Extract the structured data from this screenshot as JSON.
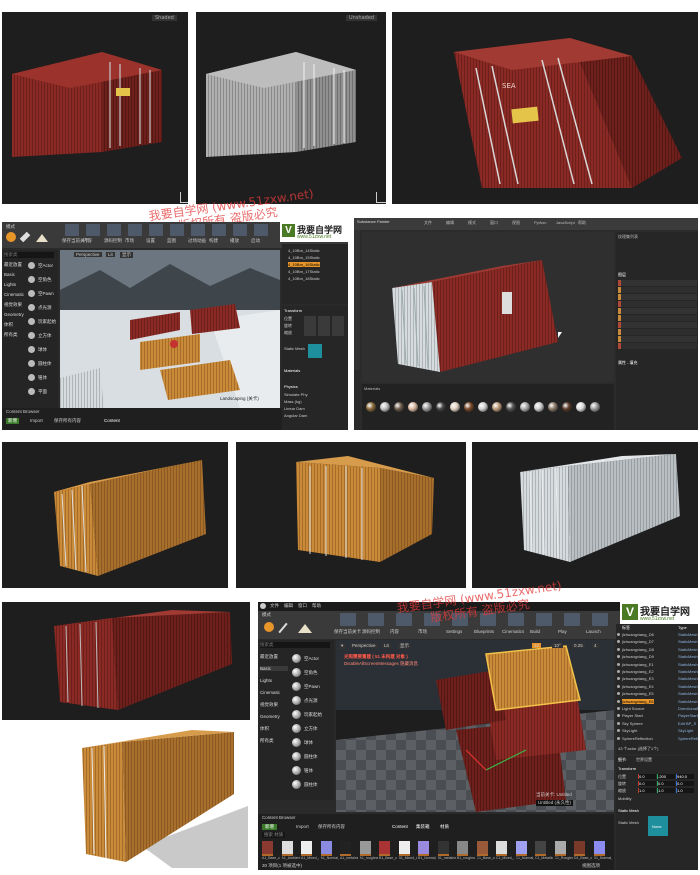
{
  "watermarks": {
    "top_line1": "我要自学网 (www.51zxw.net)",
    "top_line2": "版权所有 盗版必究",
    "bottom_line1": "我要自学网 (www.51zxw.net)",
    "bottom_line2": "版权所有 盗版必究"
  },
  "colors": {
    "red_container": "#8a2a25",
    "orange_container": "#c98a3a",
    "white_container": "#cfd4d6",
    "gray_container": "#a8a8a8",
    "ue_bg": "#2a2a2a",
    "accent_orange": "#e8962a"
  },
  "renders_top": {
    "p1_dropdown": "Shaded",
    "p2_dropdown": "Unshaded"
  },
  "ue_top": {
    "toolbar": [
      "保存当前关卡",
      "内容",
      "源码控制",
      "市场",
      "设置",
      "蓝图",
      "过场动画",
      "构建",
      "播放",
      "启动"
    ],
    "modes_label": "模式",
    "search_placeholder": "搜索类",
    "side_items": [
      "最近放置",
      "Basic",
      "Lights",
      "Cinematic",
      "视觉效果",
      "Geometry",
      "体积",
      "所有类"
    ],
    "place_items": [
      "空Actor",
      "空角色",
      "空Pawn",
      "点光源",
      "玩家起始",
      "立方体",
      "球体",
      "圆柱体",
      "锥体",
      "平面"
    ],
    "viewport_label": "Perspective",
    "viewport_lit": "Lit",
    "viewport_show": "显示",
    "viewport_name": "Landscaping (关卡)",
    "content_browser": "Content Browser",
    "add_new": "新增",
    "import_label": "Import",
    "save_all": "保存所有内容",
    "content_path": "Content",
    "outliner_rows": [
      "4_10Bm_14Static",
      "4_10Bm_15Static",
      "4_10Bm_16Static",
      "4_10Bm_17Static",
      "4_10Bm_18Static"
    ],
    "details": {
      "transform": "Transform",
      "location": "位置",
      "rotation": "旋转",
      "scale": "缩放",
      "static_mesh": "Static Mesh",
      "materials": "Materials",
      "physics": "Physics",
      "simulate": "Simulate Phy",
      "mass": "Mass (kg)",
      "linear_damp": "Linear Dam",
      "angular_damp": "Angular Dam"
    }
  },
  "sp": {
    "title": "Substance Painter",
    "tabs": [
      "文件",
      "编辑",
      "模式",
      "窗口",
      "视图",
      "Python",
      "JavaScript",
      "帮助"
    ],
    "shelf_label": "Materials",
    "layers_label": "图层",
    "properties_label": "属性 - 填充",
    "texture_set": "纹理集列表"
  },
  "ue_bottom": {
    "menu": [
      "文件",
      "编辑",
      "窗口",
      "帮助"
    ],
    "modes_label": "模式",
    "search_placeholder": "搜索类",
    "side_items": [
      "最近放置",
      "Basic",
      "Lights",
      "Cinematic",
      "视觉效果",
      "Geometry",
      "体积",
      "所有类"
    ],
    "place_items": [
      "空Actor",
      "空角色",
      "空Pawn",
      "点光源",
      "玩家起始",
      "立方体",
      "球体",
      "圆柱体",
      "锥体",
      "圆柱体"
    ],
    "toolbar": [
      "保存当前关卡",
      "源码控制",
      "内容",
      "市场",
      "Settings",
      "Blueprints",
      "Cinematics",
      "Build",
      "Play",
      "Launch"
    ],
    "viewport_label": "Perspective",
    "viewport_lit": "Lit",
    "viewport_show": "显示",
    "viewport_msg_title": "光照需要重建 ( 51 未构建 对象 )",
    "viewport_msg_sub": "DisableAllScreenMessages 隐藏消息",
    "viewport_level": "Untitled (永久性)",
    "viewport_level2": "当前关卡: Untitled",
    "snap_values": [
      "10",
      "10°",
      "0.25",
      "4"
    ],
    "content_browser": "Content Browser",
    "add_new": "新增",
    "import_label": "Import",
    "save_all": "保存所有内容",
    "breadcrumbs": [
      "Content",
      "集装箱",
      "材质"
    ],
    "search_label": "搜索 材质",
    "assets": [
      "A1_Base_color",
      "A1_Ambient_Occlu",
      "A1_Mixed_AO",
      "A1_Normal_DirectX",
      "A1_metalness",
      "A1_roughness",
      "B1_Base_color",
      "B1_Mixed_AO",
      "B1_Normal_DirectX",
      "B1_metalness",
      "B1_roughness",
      "C1_Base_color",
      "C1_Mixed_AO",
      "C1_Normal_OpenGL",
      "C1_Metallic",
      "C1_Roughness",
      "D1_Base_color",
      "D1_Normal_OpenGL"
    ],
    "items_count": "30 项目(1 项被选中)",
    "view_options": "视图选项",
    "outliner_header": "标签",
    "outliner_type": "Type",
    "outliner_rows": [
      "jizhuangxiang_D6",
      "jizhuangxiang_D7",
      "jizhuangxiang_D8",
      "jizhuangxiang_D9",
      "jizhuangxiang_E1",
      "jizhuangxiang_E2",
      "jizhuangxiang_E3",
      "jizhuangxiang_E4",
      "jizhuangxiang_E5",
      "jizhuangxiang_E6",
      "Light Source",
      "Player Start",
      "Sky Sphere",
      "SkyLight",
      "SphereReflection"
    ],
    "outliner_types": [
      "StaticMesh",
      "StaticMesh",
      "StaticMesh",
      "StaticMesh",
      "StaticMesh",
      "StaticMesh",
      "StaticMesh",
      "StaticMesh",
      "StaticMesh",
      "StaticMesh",
      "DirectionalL",
      "PlayerStart",
      "Edit BP_S",
      "SkyLight",
      "SphereRefl"
    ],
    "actor_count": "43 个actor (选择了1个)",
    "details_tab": "细节",
    "world_settings": "世界设置",
    "transform": "Transform",
    "location": "位置",
    "rotation": "旋转",
    "scale": "缩放",
    "mobility": "Mobility",
    "loc_vals": [
      "0.0",
      "-200",
      "940.0"
    ],
    "rot_vals": [
      "0.0",
      "0.0",
      "0.0"
    ],
    "scale_vals": [
      "1.0",
      "1.0",
      "1.0"
    ],
    "static_mesh": "Static Mesh",
    "static_mesh_label": "Static Mesh",
    "mesh_name": "None"
  },
  "logo": {
    "cn": "我要自学网",
    "url": "www.51zxw.net"
  }
}
